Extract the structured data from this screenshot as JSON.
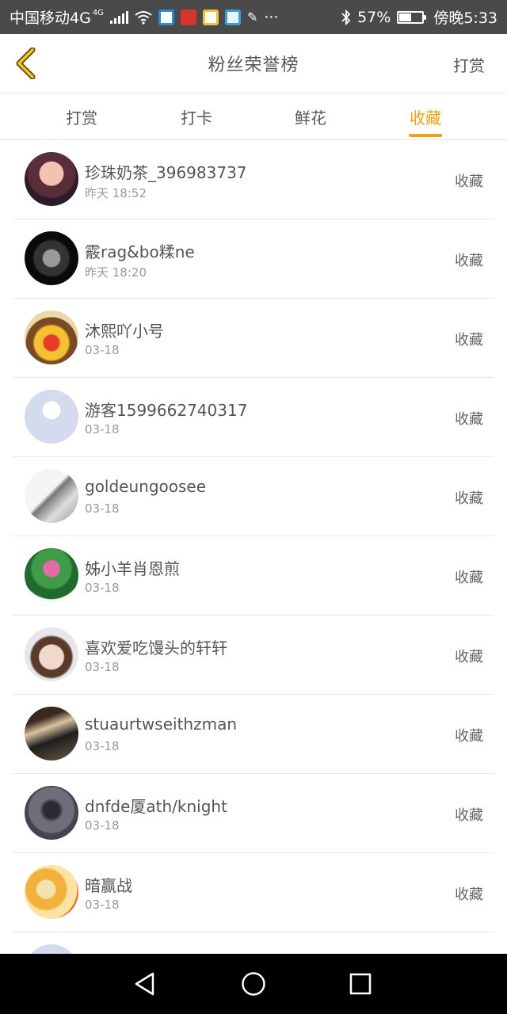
{
  "status_bar": {
    "carrier": "中国移动4G",
    "network_badge": "4G",
    "more": "···",
    "battery_percent": "57%",
    "battery_level": 0.57,
    "time": "傍晚5:33"
  },
  "header": {
    "title": "粉丝荣誉榜",
    "action_label": "打赏"
  },
  "tabs": [
    {
      "label": "打赏",
      "active": false
    },
    {
      "label": "打卡",
      "active": false
    },
    {
      "label": "鲜花",
      "active": false
    },
    {
      "label": "收藏",
      "active": true
    }
  ],
  "list": [
    {
      "name": "珍珠奶茶_396983737",
      "time": "昨天 18:52",
      "action": "收藏"
    },
    {
      "name": "霰rag&bo糅ne",
      "time": "昨天 18:20",
      "action": "收藏"
    },
    {
      "name": "沐熙吖小号",
      "time": "03-18",
      "action": "收藏"
    },
    {
      "name": "游客1599662740317",
      "time": "03-18",
      "action": "收藏"
    },
    {
      "name": "goldeungoosee",
      "time": "03-18",
      "action": "收藏"
    },
    {
      "name": "姊小羊肖恩煎",
      "time": "03-18",
      "action": "收藏"
    },
    {
      "name": "喜欢爱吃馒头的轩轩",
      "time": "03-18",
      "action": "收藏"
    },
    {
      "name": "stuaurtwseithzman",
      "time": "03-18",
      "action": "收藏"
    },
    {
      "name": "dnfde厦ath/knight",
      "time": "03-18",
      "action": "收藏"
    },
    {
      "name": "暗赢战",
      "time": "03-18",
      "action": "收藏"
    }
  ],
  "colors": {
    "accent": "#f0a010",
    "status_bar_bg": "#4a4a4a",
    "nav_bar_bg": "#000000",
    "text_primary": "#555555",
    "text_secondary": "#999999"
  }
}
